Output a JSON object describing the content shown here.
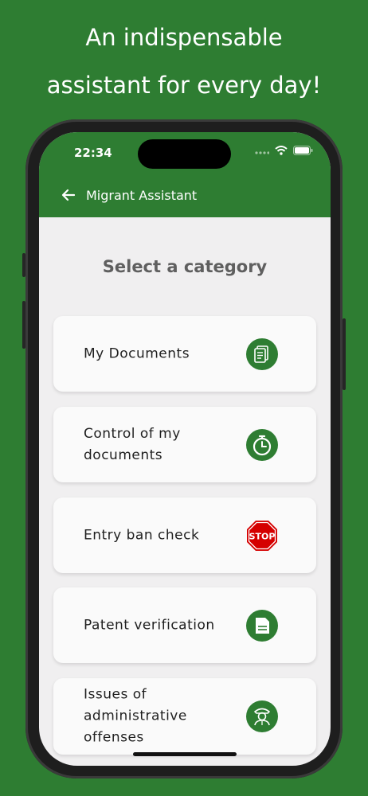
{
  "promo": {
    "line1": "An indispensable",
    "line2": "assistant for every day!"
  },
  "status_bar": {
    "time": "22:34"
  },
  "app_bar": {
    "title": "Migrant Assistant",
    "back_icon": "arrow-left-icon"
  },
  "heading": "Select a category",
  "categories": [
    {
      "label_lines": [
        "My Documents"
      ],
      "icon": "documents-icon"
    },
    {
      "label_lines": [
        "Control of my",
        "documents"
      ],
      "icon": "timer-icon"
    },
    {
      "label_lines": [
        "Entry ban check"
      ],
      "icon": "stop-sign-icon",
      "icon_text": "STOP"
    },
    {
      "label_lines": [
        "Patent verification"
      ],
      "icon": "patent-document-icon"
    },
    {
      "label_lines": [
        "Issues of",
        "administrative",
        "offenses"
      ],
      "icon": "police-officer-icon"
    }
  ],
  "colors": {
    "brand_green": "#2e7d32",
    "icon_green": "#2e7d32",
    "stop_red": "#d50000",
    "background": "#f0eff0",
    "card": "#fafafa"
  }
}
